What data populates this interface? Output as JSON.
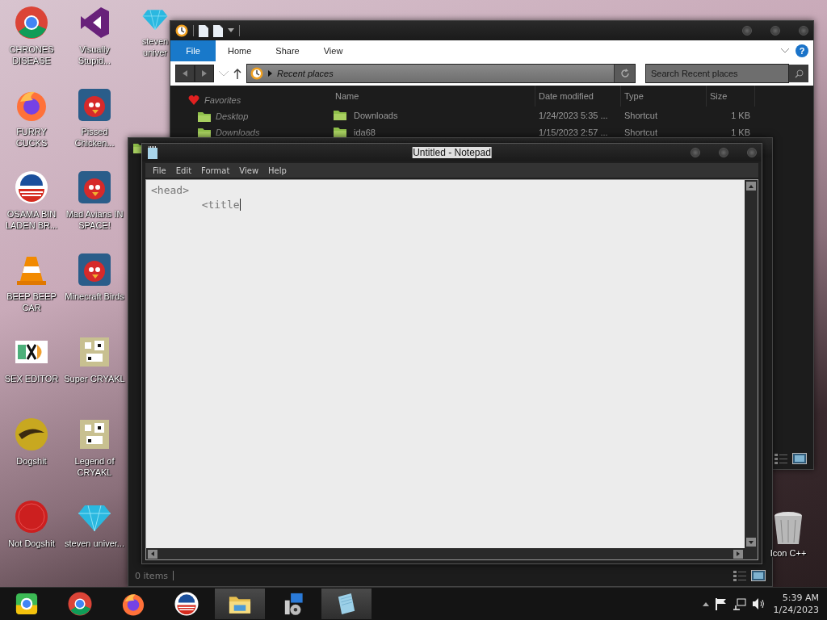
{
  "desktop_icons": [
    {
      "label": "CHRONES DISEASE",
      "kind": "ring"
    },
    {
      "label": "FURRY CUCKS",
      "kind": "flame"
    },
    {
      "label": "OSAMA BIN LADEN BR...",
      "kind": "stripes"
    },
    {
      "label": "BEEP BEEP CAR",
      "kind": "cone"
    },
    {
      "label": "SEX EDITOR",
      "kind": "hex"
    },
    {
      "label": "Dogshit",
      "kind": "disc"
    },
    {
      "label": "Not Dogshit",
      "kind": "badge"
    },
    {
      "label": "Visually Stupid...",
      "kind": "ribbon"
    },
    {
      "label": "Pissed Chicken...",
      "kind": "bird"
    },
    {
      "label": "Mad Avians IN SPACE!",
      "kind": "bird"
    },
    {
      "label": "Minecraft Birds",
      "kind": "bird"
    },
    {
      "label": "Super CRYAKL",
      "kind": "pixel"
    },
    {
      "label": "Legend of CRYAKL",
      "kind": "pixel"
    },
    {
      "label": "steven univer...",
      "kind": "diamond"
    },
    {
      "label": "steven univer",
      "kind": "gem"
    }
  ],
  "explorer": {
    "ribbon_tabs": [
      {
        "label": "File",
        "selected": true
      },
      {
        "label": "Home",
        "selected": false
      },
      {
        "label": "Share",
        "selected": false
      },
      {
        "label": "View",
        "selected": false
      }
    ],
    "help": "?",
    "address": "Recent places",
    "search": {
      "placeholder": "Search Recent places"
    },
    "favorites": "Favorites",
    "nav_items": [
      "Desktop",
      "Downloads"
    ],
    "columns": [
      "Name",
      "Date modified",
      "Type",
      "Size"
    ],
    "rows": [
      {
        "name": "Downloads",
        "date": "1/24/2023 5:35 ...",
        "type": "Shortcut",
        "size": "1 KB"
      },
      {
        "name": "ida68",
        "date": "1/15/2023 2:57 ...",
        "type": "Shortcut",
        "size": "1 KB"
      }
    ]
  },
  "back_window": {
    "status": "0 items"
  },
  "notepad": {
    "title": "Untitled - Notepad",
    "menu": [
      "File",
      "Edit",
      "Format",
      "View",
      "Help"
    ],
    "text": "<head>\n\t<title"
  },
  "recycle_bin": {
    "label": "Icon C++"
  },
  "taskbar": {
    "apps": [
      {
        "kind": "orb",
        "active": false
      },
      {
        "kind": "ring",
        "active": false
      },
      {
        "kind": "flame",
        "active": false
      },
      {
        "kind": "stripes",
        "active": false
      },
      {
        "kind": "folder",
        "active": true
      },
      {
        "kind": "installer",
        "active": false
      },
      {
        "kind": "notepad",
        "active": true
      }
    ],
    "time": "5:39 AM",
    "date": "1/24/2023"
  }
}
